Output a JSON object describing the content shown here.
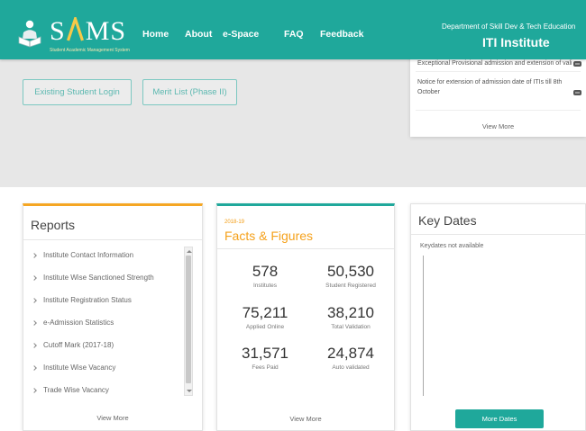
{
  "header": {
    "logo": {
      "text": "SAMS",
      "tagline": "Student Academic Management System",
      "icon": "student-reading-icon"
    },
    "nav": [
      {
        "label": "Home"
      },
      {
        "label": "About"
      },
      {
        "label": "e-Space"
      },
      {
        "label": "FAQ"
      },
      {
        "label": "Feedback"
      }
    ],
    "department": "Department of Skill Dev & Tech Education",
    "institute": "ITI Institute"
  },
  "hero": {
    "buttons": {
      "existing_login": "Existing Student Login",
      "merit_list": "Merit List (Phase II)"
    }
  },
  "notices": {
    "items": [
      "Exceptional Provisional admission and extension of validation",
      "Notice for extension of admission date of ITIs till 8th October"
    ],
    "badge_icon": "new-badge-icon",
    "view_more": "View More"
  },
  "reports": {
    "title": "Reports",
    "bullet_icon": "chevron-right-icon",
    "items": [
      "Institute Contact Information",
      "Institute Wise Sanctioned Strength",
      "Institute Registration Status",
      "e-Admission Statistics",
      "Cutoff Mark (2017-18)",
      "Institute Wise Vacancy",
      "Trade Wise Vacancy"
    ],
    "view_more": "View More"
  },
  "facts": {
    "year": "2018-19",
    "title": "Facts & Figures",
    "stats": [
      {
        "value": "578",
        "label": "Institutes"
      },
      {
        "value": "50,530",
        "label": "Student Registered"
      },
      {
        "value": "75,211",
        "label": "Applied Online"
      },
      {
        "value": "38,210",
        "label": "Total Validation"
      },
      {
        "value": "31,571",
        "label": "Fees Paid"
      },
      {
        "value": "24,874",
        "label": "Auto validated"
      }
    ],
    "view_more": "View More"
  },
  "key_dates": {
    "title": "Key Dates",
    "empty_message": "Keydates not available",
    "button": "More Dates"
  },
  "colors": {
    "header_bg": "#1fa89b",
    "accent_orange": "#f5a623",
    "hero_bg": "#e7e7e7",
    "logo_triangle": "#f7c948"
  }
}
